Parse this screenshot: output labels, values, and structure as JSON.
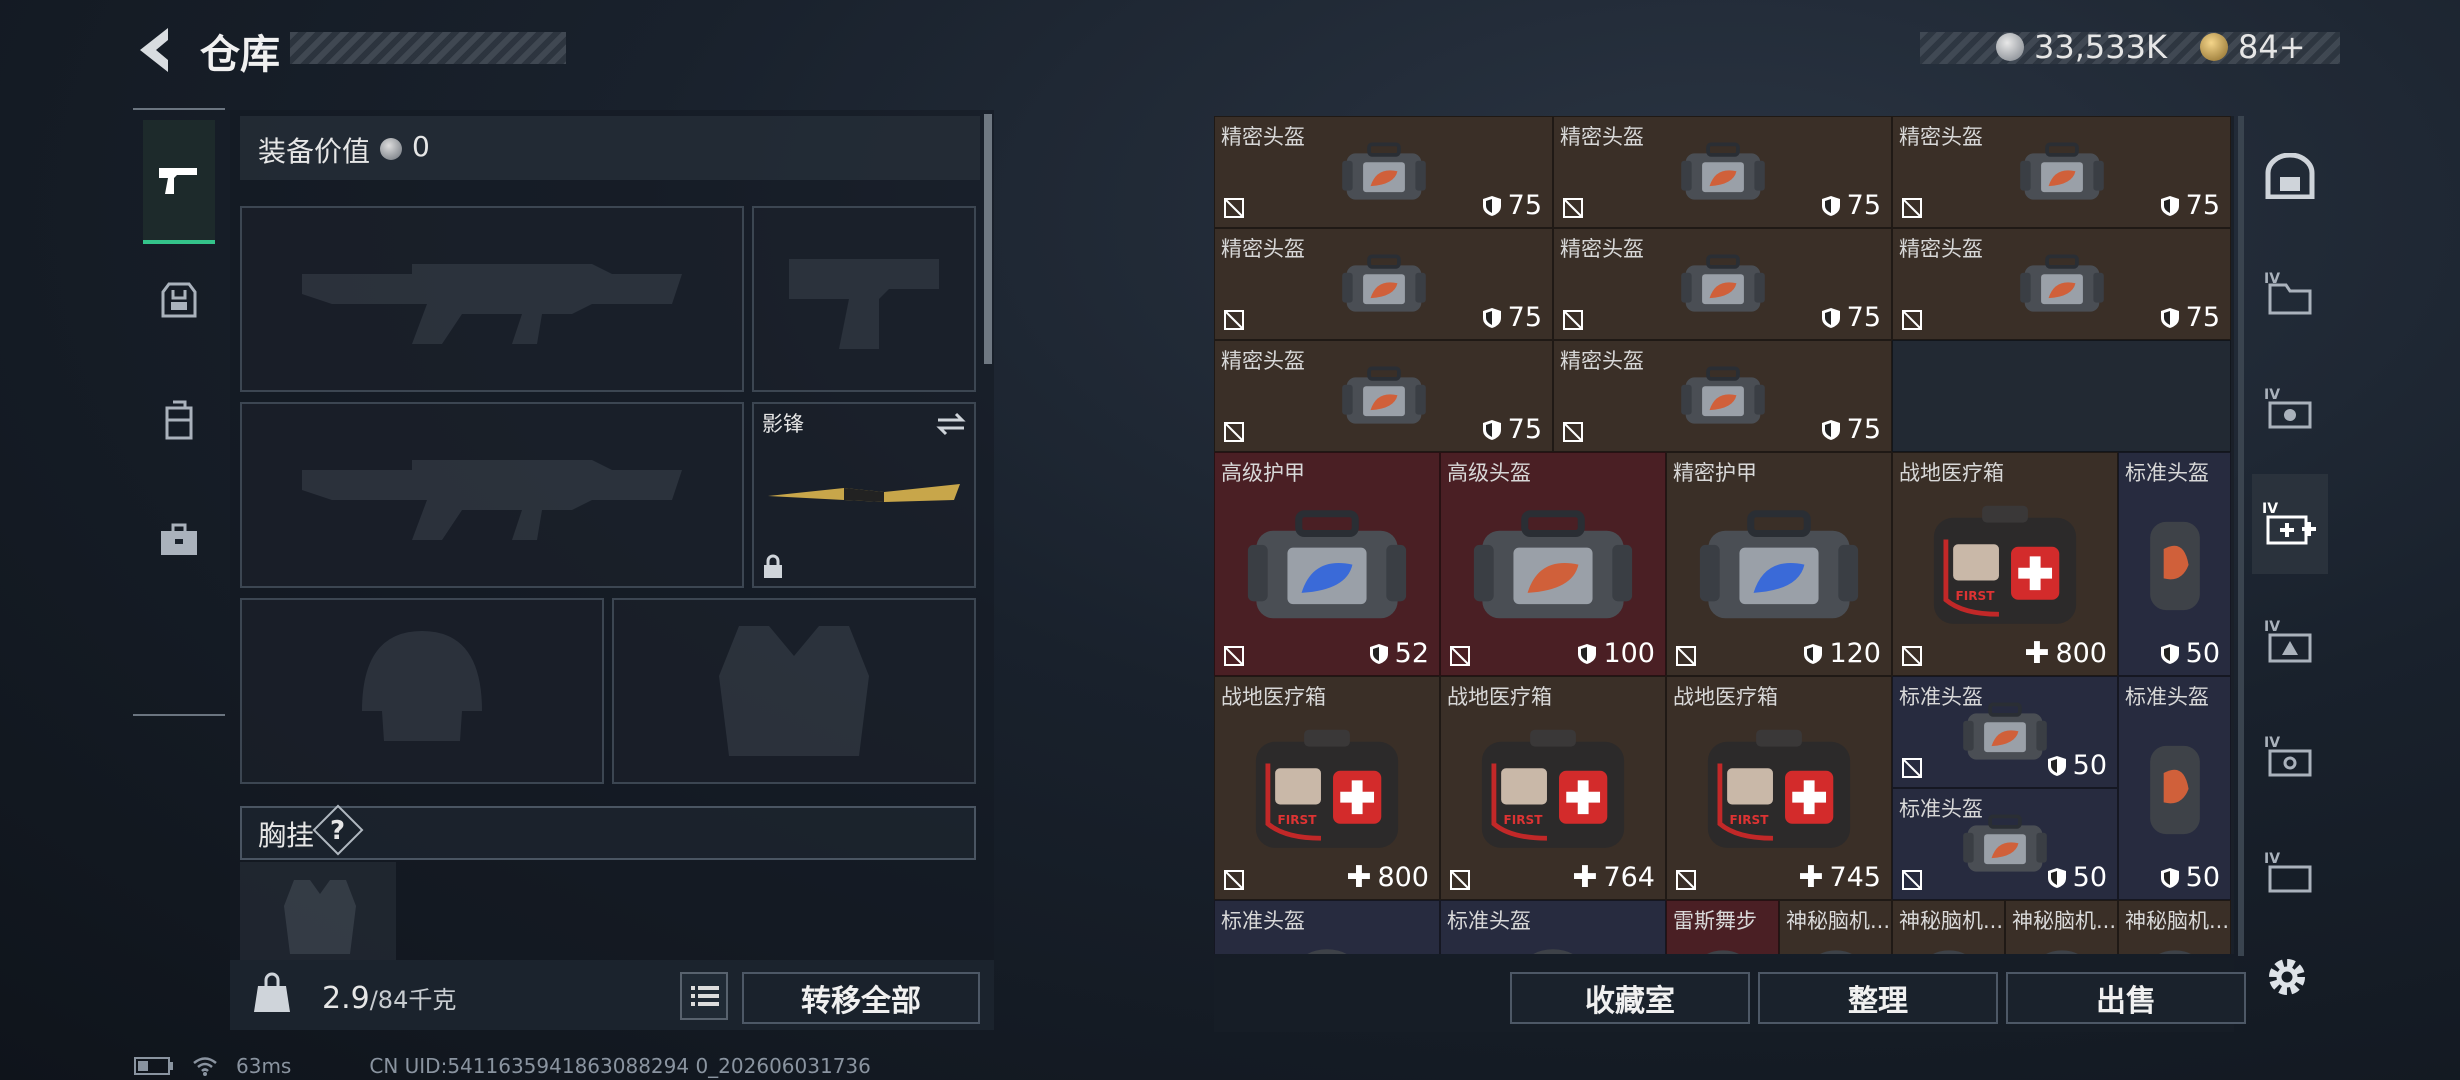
{
  "header": {
    "title": "仓库",
    "currency1": "33,533K",
    "currency2": "84+"
  },
  "equipment": {
    "value_label": "装备价值",
    "value": "0",
    "melee_name": "影锋",
    "chest_label": "胸挂",
    "chest_help": "?"
  },
  "bottom_left": {
    "weight": "2.9",
    "weight_cap": "/84千克",
    "transfer_all": "转移全部"
  },
  "stash": {
    "items": [
      {
        "name": "精密头盔",
        "value": "75",
        "icon": "shield"
      },
      {
        "name": "精密头盔",
        "value": "75",
        "icon": "shield"
      },
      {
        "name": "精密头盔",
        "value": "75",
        "icon": "shield"
      },
      {
        "name": "精密头盔",
        "value": "75",
        "icon": "shield"
      },
      {
        "name": "精密头盔",
        "value": "75",
        "icon": "shield"
      },
      {
        "name": "精密头盔",
        "value": "75",
        "icon": "shield"
      },
      {
        "name": "精密头盔",
        "value": "75",
        "icon": "shield"
      },
      {
        "name": "精密头盔",
        "value": "75",
        "icon": "shield"
      },
      {
        "name": "高级护甲",
        "value": "52",
        "icon": "shield"
      },
      {
        "name": "高级头盔",
        "value": "100",
        "icon": "shield"
      },
      {
        "name": "精密护甲",
        "value": "120",
        "icon": "shield"
      },
      {
        "name": "战地医疗箱",
        "value": "800",
        "icon": "plus"
      },
      {
        "name": "标准头盔",
        "value": "50",
        "icon": "shield"
      },
      {
        "name": "战地医疗箱",
        "value": "800",
        "icon": "plus"
      },
      {
        "name": "战地医疗箱",
        "value": "764",
        "icon": "plus"
      },
      {
        "name": "战地医疗箱",
        "value": "745",
        "icon": "plus"
      },
      {
        "name": "标准头盔",
        "value": "50",
        "icon": "shield"
      },
      {
        "name": "标准头盔",
        "value": "50",
        "icon": "shield"
      },
      {
        "name": "标准头盔",
        "value": "50",
        "icon": "shield"
      },
      {
        "name": "标准头盔",
        "value": "",
        "icon": ""
      },
      {
        "name": "标准头盔",
        "value": "",
        "icon": ""
      },
      {
        "name": "雷斯舞步",
        "value": "",
        "icon": ""
      },
      {
        "name": "神秘脑机...",
        "value": "",
        "icon": ""
      },
      {
        "name": "神秘脑机...",
        "value": "",
        "icon": ""
      },
      {
        "name": "神秘脑机...",
        "value": "",
        "icon": ""
      },
      {
        "name": "神秘脑机...",
        "value": "",
        "icon": ""
      }
    ]
  },
  "bottom_right": {
    "collection": "收藏室",
    "sort": "整理",
    "sell": "出售"
  },
  "status": {
    "ping": "63ms",
    "uid": "CN UID:5411635941863088294 0_202606031736"
  },
  "colors": {
    "accent_green": "#34c38a",
    "cell_brown": "#3a2f27",
    "cell_red": "#4a1f24",
    "cell_blue": "#272b3f"
  }
}
